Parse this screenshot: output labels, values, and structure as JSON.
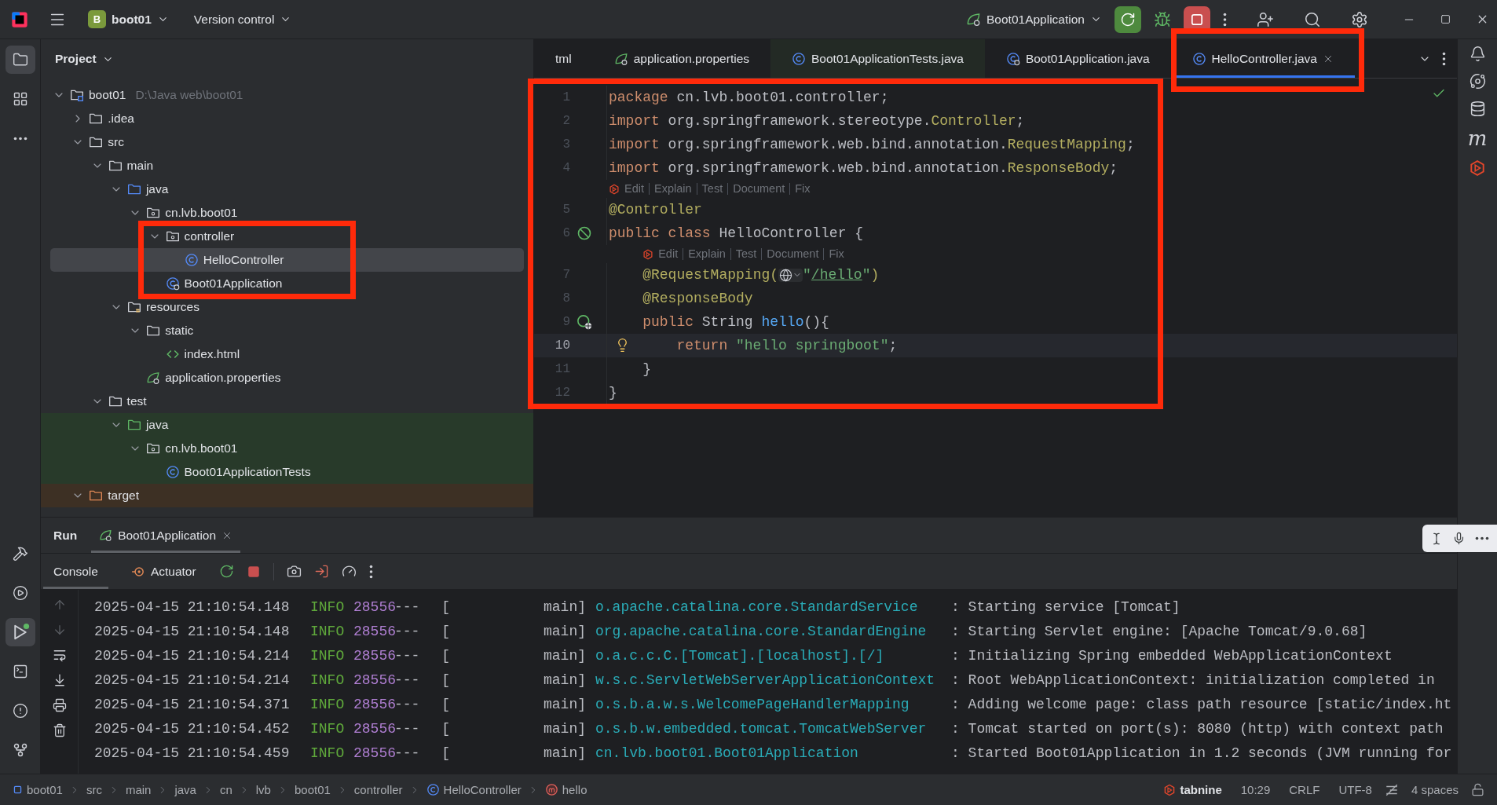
{
  "title_bar": {
    "project_badge": "B",
    "project": "boot01",
    "vcs": "Version control",
    "run_config": "Boot01Application"
  },
  "left_toolbar": {
    "top": [
      {
        "kind": "folder",
        "selected": true
      },
      {
        "kind": "structure",
        "selected": false
      },
      {
        "kind": "more",
        "selected": false
      }
    ],
    "bottom": [
      {
        "kind": "build",
        "selected": false
      },
      {
        "kind": "services",
        "selected": false
      },
      {
        "kind": "run",
        "selected": true
      },
      {
        "kind": "terminal",
        "selected": false
      },
      {
        "kind": "problems",
        "selected": false
      },
      {
        "kind": "git",
        "selected": false
      }
    ]
  },
  "project_panel": {
    "title": "Project",
    "tree": [
      {
        "label": "boot01",
        "kind": "module",
        "path": "D:\\Java web\\boot01",
        "expanded": true,
        "selected": false,
        "highlighted": false,
        "children": [
          {
            "label": ".idea",
            "kind": "folder",
            "expanded": false,
            "selected": false,
            "highlighted": false
          },
          {
            "label": "src",
            "kind": "folder",
            "expanded": true,
            "selected": false,
            "highlighted": false,
            "children": [
              {
                "label": "main",
                "kind": "folder",
                "expanded": true,
                "selected": false,
                "highlighted": false,
                "children": [
                  {
                    "label": "java",
                    "kind": "source",
                    "expanded": true,
                    "selected": false,
                    "highlighted": false,
                    "children": [
                      {
                        "label": "cn.lvb.boot01",
                        "kind": "package",
                        "expanded": true,
                        "selected": false,
                        "highlighted": false,
                        "children": [
                          {
                            "label": "controller",
                            "kind": "package",
                            "expanded": true,
                            "selected": false,
                            "highlighted": true,
                            "children": [
                              {
                                "label": "HelloController",
                                "kind": "class",
                                "selected": true,
                                "highlighted": true
                              }
                            ]
                          },
                          {
                            "label": "Boot01Application",
                            "kind": "app",
                            "selected": false,
                            "highlighted": true
                          }
                        ]
                      }
                    ]
                  },
                  {
                    "label": "resources",
                    "kind": "resources",
                    "expanded": true,
                    "selected": false,
                    "highlighted": false,
                    "children": [
                      {
                        "label": "static",
                        "kind": "folder",
                        "expanded": true,
                        "selected": false,
                        "highlighted": false,
                        "children": [
                          {
                            "label": "index.html",
                            "kind": "html",
                            "selected": false,
                            "highlighted": false
                          }
                        ]
                      },
                      {
                        "label": "application.properties",
                        "kind": "properties",
                        "selected": false,
                        "highlighted": false
                      }
                    ]
                  }
                ]
              },
              {
                "label": "test",
                "kind": "folder",
                "expanded": true,
                "selected": false,
                "highlighted": false,
                "children": [
                  {
                    "label": "java",
                    "kind": "test_source",
                    "expanded": true,
                    "selected": false,
                    "highlighted": false,
                    "children": [
                      {
                        "label": "cn.lvb.boot01",
                        "kind": "package",
                        "expanded": true,
                        "selected": false,
                        "highlighted": false,
                        "children": [
                          {
                            "label": "Boot01ApplicationTests",
                            "kind": "class",
                            "selected": false,
                            "highlighted": false
                          }
                        ]
                      }
                    ]
                  }
                ]
              }
            ]
          },
          {
            "label": "target",
            "kind": "excluded",
            "expanded": true,
            "selected": false,
            "highlighted": false
          }
        ]
      }
    ]
  },
  "editor": {
    "highlighted": true,
    "tabs": [
      {
        "label": "tml",
        "kind": "plain",
        "selected": false,
        "highlighted": false
      },
      {
        "label": "application.properties",
        "kind": "properties",
        "selected": false,
        "highlighted": false
      },
      {
        "label": "Boot01ApplicationTests.java",
        "kind": "class",
        "selected": false,
        "highlighted": false
      },
      {
        "label": "Boot01Application.java",
        "kind": "app",
        "selected": false,
        "highlighted": false
      },
      {
        "label": "HelloController.java",
        "kind": "class",
        "selected": true,
        "highlighted": true
      }
    ],
    "lines": [
      {
        "number": "1",
        "current": false,
        "segments": [
          {
            "kind": "keyword",
            "text": "package"
          },
          {
            "kind": "plain",
            "text": " cn.lvb.boot01.controller;"
          }
        ]
      },
      {
        "number": "2",
        "current": false,
        "segments": [
          {
            "kind": "keyword",
            "text": "import"
          },
          {
            "kind": "plain",
            "text": " org.springframework.stereotype."
          },
          {
            "kind": "annotation",
            "text": "Controller"
          },
          {
            "kind": "plain",
            "text": ";"
          }
        ]
      },
      {
        "number": "3",
        "current": false,
        "segments": [
          {
            "kind": "keyword",
            "text": "import"
          },
          {
            "kind": "plain",
            "text": " org.springframework.web.bind.annotation."
          },
          {
            "kind": "annotation",
            "text": "RequestMapping"
          },
          {
            "kind": "plain",
            "text": ";"
          }
        ]
      },
      {
        "number": "4",
        "current": false,
        "segments": [
          {
            "kind": "keyword",
            "text": "import"
          },
          {
            "kind": "plain",
            "text": " org.springframework.web.bind.annotation."
          },
          {
            "kind": "annotation",
            "text": "ResponseBody"
          },
          {
            "kind": "plain",
            "text": ";"
          }
        ]
      },
      {
        "number": "5",
        "current": false,
        "lens": [
          "Edit",
          "Explain",
          "Test",
          "Document",
          "Fix"
        ],
        "segments": [
          {
            "kind": "annotation",
            "text": "@Controller"
          }
        ]
      },
      {
        "number": "6",
        "current": false,
        "gutter": {
          "kind": "bean"
        },
        "segments": [
          {
            "kind": "keyword",
            "text": "public class"
          },
          {
            "kind": "plain",
            "text": " HelloController {"
          }
        ]
      },
      {
        "number": "7",
        "current": false,
        "lens": [
          "Edit",
          "Explain",
          "Test",
          "Document",
          "Fix"
        ],
        "segments": [
          {
            "kind": "annotation",
            "text": "    @RequestMapping("
          },
          {
            "kind": "globe"
          },
          {
            "kind": "string",
            "text": "\""
          },
          {
            "kind": "link",
            "text": "/hello"
          },
          {
            "kind": "string",
            "text": "\""
          },
          {
            "kind": "annotation",
            "text": ")"
          }
        ]
      },
      {
        "number": "8",
        "current": false,
        "segments": [
          {
            "kind": "annotation",
            "text": "    @ResponseBody"
          }
        ]
      },
      {
        "number": "9",
        "current": false,
        "gutter": {
          "kind": "endpoint"
        },
        "segments": [
          {
            "kind": "keyword",
            "text": "    public"
          },
          {
            "kind": "plain",
            "text": " String "
          },
          {
            "kind": "method",
            "text": "hello"
          },
          {
            "kind": "plain",
            "text": "(){"
          }
        ]
      },
      {
        "number": "10",
        "current": true,
        "gutter": {
          "kind": "bulb"
        },
        "segments": [
          {
            "kind": "keyword",
            "text": "        return"
          },
          {
            "kind": "string",
            "text": " \"hello springboot\""
          },
          {
            "kind": "plain",
            "text": ";"
          }
        ]
      },
      {
        "number": "11",
        "current": false,
        "segments": [
          {
            "kind": "plain",
            "text": "    }"
          }
        ]
      },
      {
        "number": "12",
        "current": false,
        "segments": [
          {
            "kind": "plain",
            "text": "}"
          }
        ]
      }
    ]
  },
  "right_toolbar": {
    "glyph": "m"
  },
  "bottom_panel": {
    "title": "Run",
    "tabs": [
      {
        "label": "Boot01Application",
        "selected": true
      }
    ],
    "console_tabs": [
      {
        "label": "Console",
        "kind": "console",
        "selected": true
      },
      {
        "label": "Actuator",
        "kind": "actuator",
        "selected": false
      }
    ],
    "log": [
      {
        "time": "2025-04-15 21:10:54.148",
        "level": "INFO",
        "pid": "28556",
        "separator": "--- [",
        "thread": "main]",
        "logger": "o.apache.catalina.core.StandardService",
        "message": ": Starting service [Tomcat]"
      },
      {
        "time": "2025-04-15 21:10:54.148",
        "level": "INFO",
        "pid": "28556",
        "separator": "--- [",
        "thread": "main]",
        "logger": "org.apache.catalina.core.StandardEngine",
        "message": ": Starting Servlet engine: [Apache Tomcat/9.0.68]"
      },
      {
        "time": "2025-04-15 21:10:54.214",
        "level": "INFO",
        "pid": "28556",
        "separator": "--- [",
        "thread": "main]",
        "logger": "o.a.c.c.C.[Tomcat].[localhost].[/]",
        "message": ": Initializing Spring embedded WebApplicationContext"
      },
      {
        "time": "2025-04-15 21:10:54.214",
        "level": "INFO",
        "pid": "28556",
        "separator": "--- [",
        "thread": "main]",
        "logger": "w.s.c.ServletWebServerApplicationContext",
        "message": ": Root WebApplicationContext: initialization completed in"
      },
      {
        "time": "2025-04-15 21:10:54.371",
        "level": "INFO",
        "pid": "28556",
        "separator": "--- [",
        "thread": "main]",
        "logger": "o.s.b.a.w.s.WelcomePageHandlerMapping",
        "message": ": Adding welcome page: class path resource [static/index.ht"
      },
      {
        "time": "2025-04-15 21:10:54.452",
        "level": "INFO",
        "pid": "28556",
        "separator": "--- [",
        "thread": "main]",
        "logger": "o.s.b.w.embedded.tomcat.TomcatWebServer",
        "message": ": Tomcat started on port(s): 8080 (http) with context path"
      },
      {
        "time": "2025-04-15 21:10:54.459",
        "level": "INFO",
        "pid": "28556",
        "separator": "--- [",
        "thread": "main]",
        "logger": "cn.lvb.boot01.Boot01Application",
        "message": ": Started Boot01Application in 1.2 seconds (JVM running for"
      }
    ]
  },
  "status_bar": {
    "breadcrumbs": [
      {
        "label": "boot01",
        "kind": "module"
      },
      {
        "label": "src",
        "kind": "folder"
      },
      {
        "label": "main",
        "kind": "folder"
      },
      {
        "label": "java",
        "kind": "folder"
      },
      {
        "label": "cn",
        "kind": "folder"
      },
      {
        "label": "lvb",
        "kind": "folder"
      },
      {
        "label": "boot01",
        "kind": "folder"
      },
      {
        "label": "controller",
        "kind": "folder"
      },
      {
        "label": "HelloController",
        "kind": "class"
      },
      {
        "label": "hello",
        "kind": "method"
      }
    ],
    "plugin": "tabnine",
    "caret": "10:29",
    "line_separator": "CRLF",
    "encoding": "UTF-8",
    "indent": "4 spaces"
  }
}
